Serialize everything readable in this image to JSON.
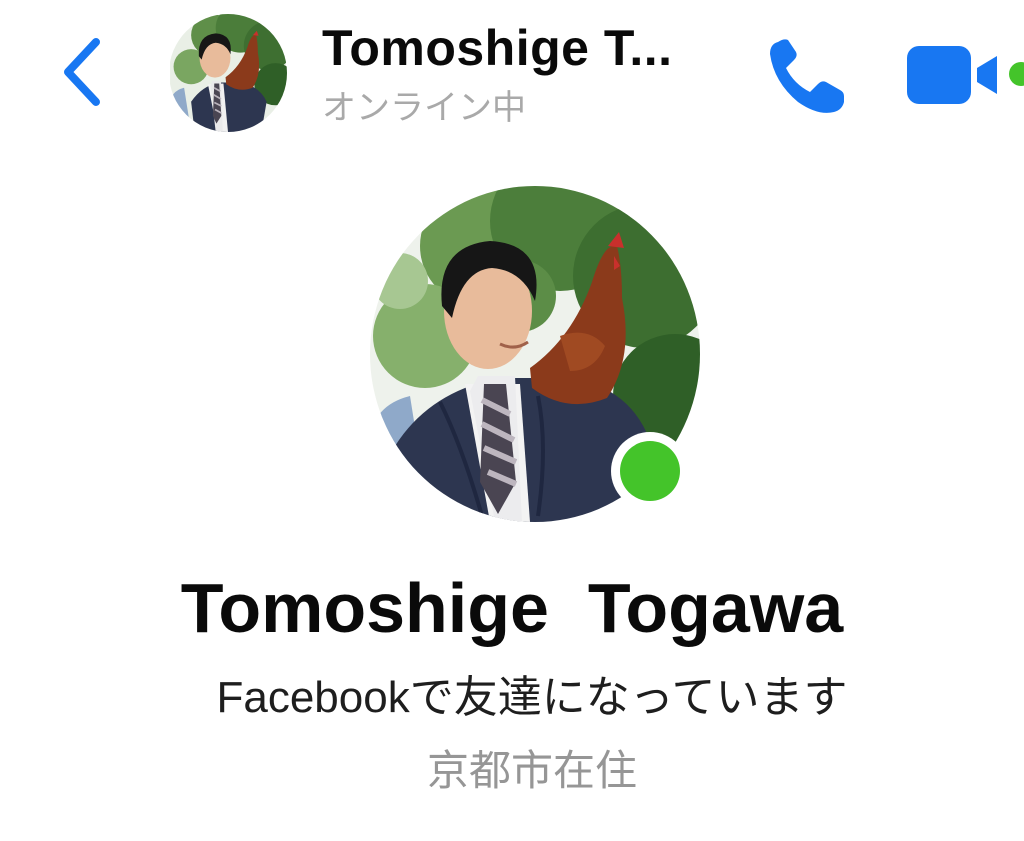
{
  "colors": {
    "accent": "#1877f2",
    "online": "#44c42a",
    "name_text": "#0a0a0a",
    "secondary_text": "#a9a9a9"
  },
  "header": {
    "back_icon": "chevron-left-icon",
    "avatar_icon": "profile-photo",
    "name": "Tomoshige  T...",
    "status": "オンライン中",
    "call_icon": "phone-icon",
    "video_icon": "video-camera-icon"
  },
  "profile": {
    "avatar_icon": "profile-photo",
    "online_indicator": "online-dot",
    "name": "Tomoshige  Togawa",
    "friend_status": "Facebookで友達になっています",
    "location": "京都市在住"
  }
}
